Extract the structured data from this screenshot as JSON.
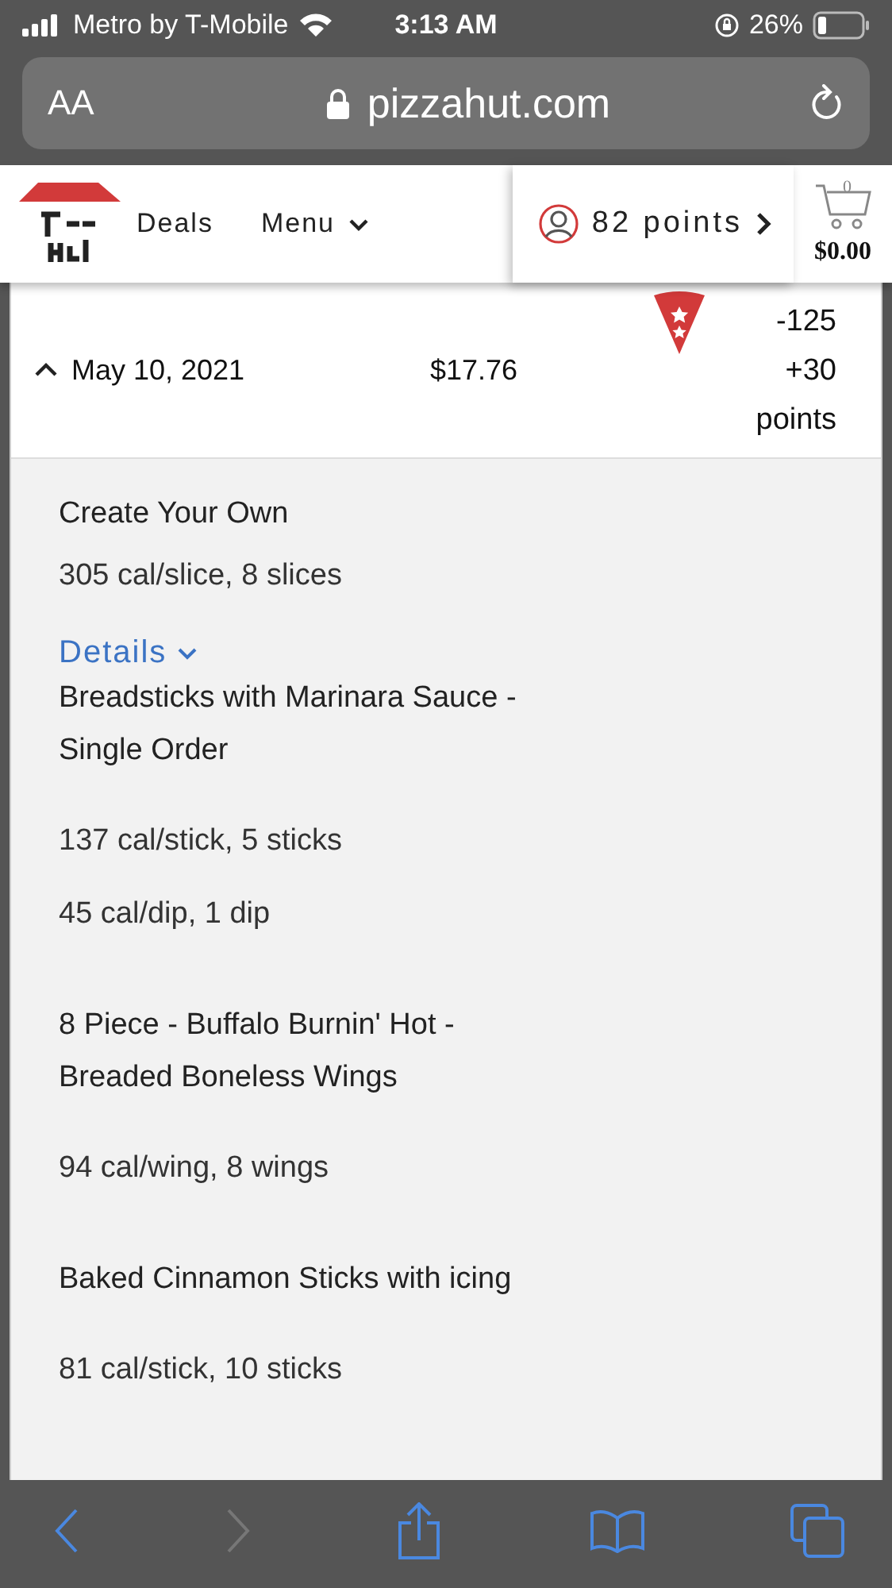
{
  "status_bar": {
    "carrier": "Metro by T-Mobile",
    "time": "3:13 AM",
    "battery": "26%"
  },
  "address_bar": {
    "text_size": "AA",
    "url": "pizzahut.com"
  },
  "header": {
    "nav": [
      {
        "label": "Deals",
        "kind": "link"
      },
      {
        "label": "Menu",
        "kind": "dropdown"
      }
    ],
    "points": "82 points",
    "cart_count": "0",
    "cart_total": "$0.00"
  },
  "order": {
    "expanded": true,
    "date": "May 10, 2021",
    "total": "$17.76",
    "points": [
      "-125",
      "+30",
      "points"
    ]
  },
  "items": [
    {
      "name": "Create Your Own",
      "info": [
        "305 cal/slice, 8 slices"
      ],
      "link": "Details"
    },
    {
      "name": "Breadsticks with Marinara Sauce - Single Order",
      "info": [
        "137 cal/stick, 5 sticks",
        "45 cal/dip, 1 dip"
      ]
    },
    {
      "name": "8 Piece - Buffalo Burnin' Hot - Breaded Boneless Wings",
      "info": [
        "94 cal/wing, 8 wings"
      ]
    },
    {
      "name": "Baked Cinnamon Sticks with icing",
      "info": [
        "81 cal/stick, 10 sticks"
      ]
    }
  ],
  "toolbar": {
    "back_disabled": false,
    "forward_disabled": true
  }
}
